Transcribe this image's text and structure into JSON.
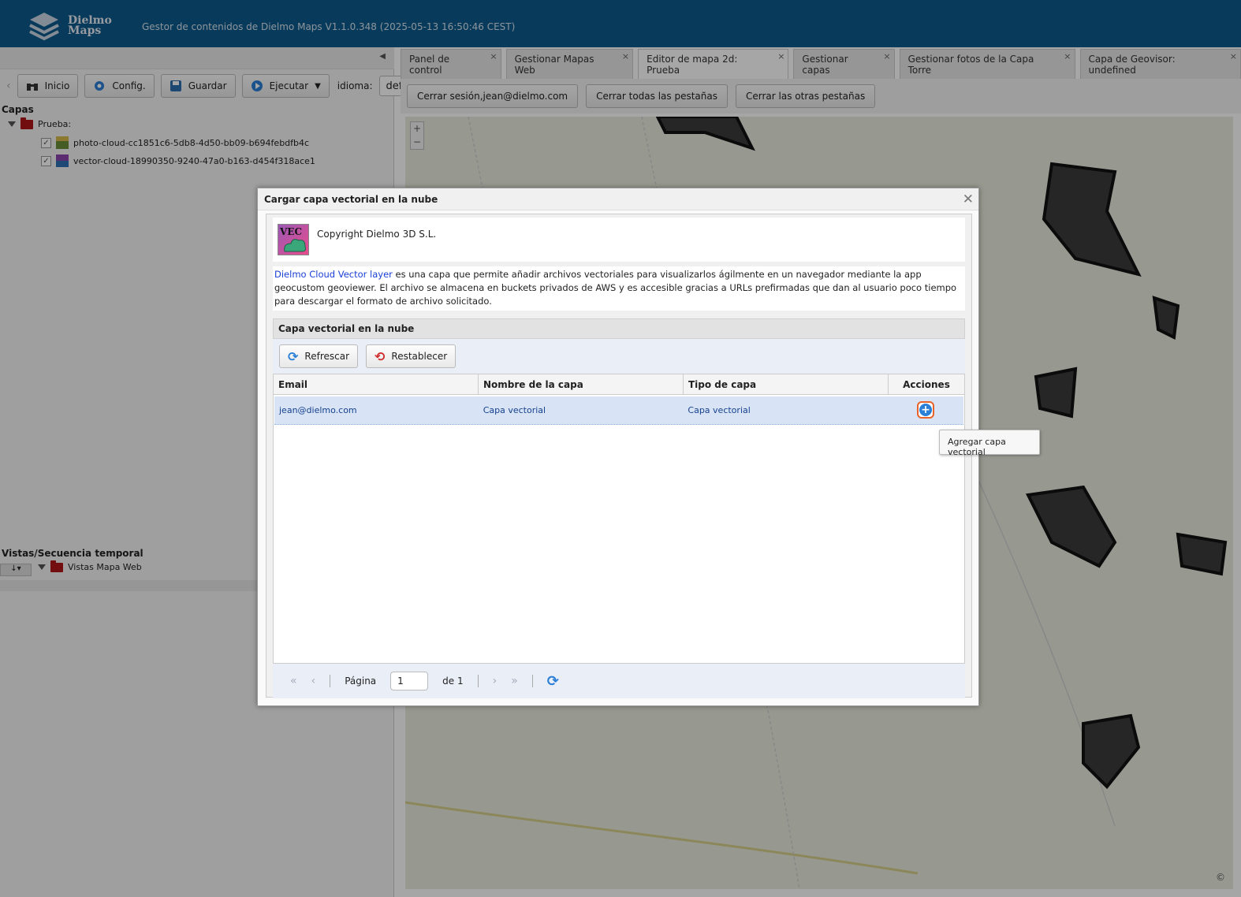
{
  "header": {
    "logo_line1": "Dielmo",
    "logo_line2": "Maps",
    "title": "Gestor de contenidos de Dielmo Maps V1.1.0.348 (2025-05-13 16:50:46 CEST)"
  },
  "toolbar": {
    "inicio": "Inicio",
    "config": "Config.",
    "guardar": "Guardar",
    "ejecutar": "Ejecutar",
    "idioma_label": "idioma:",
    "idioma_value": "default"
  },
  "layers_panel": {
    "title": "Capas",
    "root": "Prueba:",
    "items": [
      {
        "label": "photo-cloud-cc1851c6-5db8-4d50-bb09-b694febdfb4c"
      },
      {
        "label": "vector-cloud-18990350-9240-47a0-b163-d454f318ace1"
      }
    ]
  },
  "views_panel": {
    "title": "Vistas/Secuencia temporal",
    "root": "Vistas Mapa Web"
  },
  "tabs": [
    {
      "label": "Panel de control"
    },
    {
      "label": "Gestionar Mapas Web"
    },
    {
      "label": "Editor de mapa 2d: Prueba"
    },
    {
      "label": "Gestionar capas"
    },
    {
      "label": "Gestionar fotos de la Capa Torre"
    },
    {
      "label": "Capa de Geovisor: undefined"
    }
  ],
  "session_actions": {
    "logout": "Cerrar sesión,jean@dielmo.com",
    "close_all": "Cerrar todas las pestañas",
    "close_others": "Cerrar las otras pestañas"
  },
  "dialog": {
    "title": "Cargar capa vectorial en la nube",
    "icon_text": "VEC",
    "copyright": "Copyright Dielmo 3D S.L.",
    "desc_link": "Dielmo Cloud Vector layer",
    "desc_rest": " es una capa que permite añadir archivos vectoriales para visualizarlos ágilmente en un navegador mediante la app geocustom geoviewer. El archivo se almacena en buckets privados de AWS y es accesible gracias a URLs prefirmadas que dan al usuario poco tiempo para descargar el formato de archivo solicitado.",
    "panel_title": "Capa vectorial en la nube",
    "refresh": "Refrescar",
    "reset": "Restablecer",
    "columns": {
      "email": "Email",
      "name": "Nombre de la capa",
      "type": "Tipo de capa",
      "actions": "Acciones"
    },
    "rows": [
      {
        "email": "jean@dielmo.com",
        "name": "Capa vectorial",
        "type": "Capa vectorial"
      }
    ],
    "pager": {
      "page_label": "Página",
      "page_value": "1",
      "of_label": "de 1"
    },
    "tooltip": "Agregar capa vectorial"
  },
  "map": {
    "copyright_symbol": "©"
  },
  "colors": {
    "header_bg": "#0d5a8c",
    "link": "#1a3fd6",
    "accent_orange": "#e8622a",
    "accent_blue": "#2b7fd6"
  }
}
